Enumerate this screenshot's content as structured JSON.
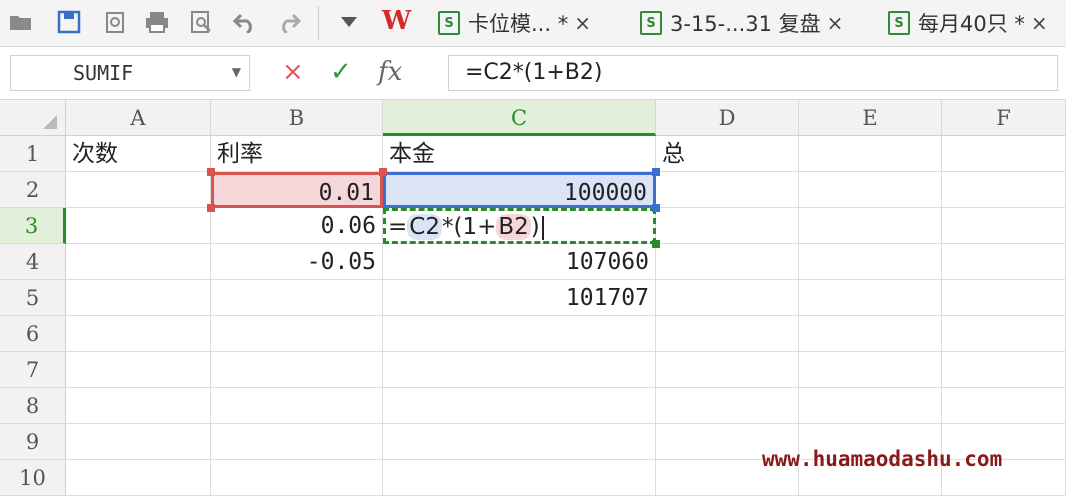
{
  "toolbar": {
    "icons": [
      "open-folder-icon",
      "save-icon",
      "export-icon",
      "print-icon",
      "print-preview-icon",
      "undo-icon",
      "redo-icon",
      "dropdown-icon"
    ],
    "brand": "W",
    "tabs": [
      {
        "label": "卡位模... *",
        "close": "×"
      },
      {
        "label": "3-15-...31 复盘",
        "close": "×"
      },
      {
        "label": "每月40只 *",
        "close": "×"
      }
    ]
  },
  "formula_bar": {
    "name_box": "SUMIF",
    "cancel": "×",
    "confirm": "✓",
    "fx": "fx",
    "formula": "=C2*(1+B2)"
  },
  "sheet": {
    "columns": [
      "A",
      "B",
      "C",
      "D",
      "E",
      "F"
    ],
    "rows": [
      "1",
      "2",
      "3",
      "4",
      "5",
      "6",
      "7",
      "8",
      "9",
      "10"
    ],
    "cells": {
      "A1": "次数",
      "B1": "利率",
      "C1": "本金",
      "D1": "总",
      "B2": "0.01",
      "C2": "100000",
      "B3": "0.06",
      "B4": "-0.05",
      "C4": "107060",
      "C5": "101707"
    },
    "editing": {
      "eq": "=",
      "ref1": "C2",
      "mid": "*(1+",
      "ref2": "B2",
      "end": ")"
    },
    "ref_colors": {
      "B2": "#d9534f",
      "C2": "#3b6fd4",
      "active": "#2a8a2a"
    }
  },
  "watermark": "www.huamaodashu.com"
}
